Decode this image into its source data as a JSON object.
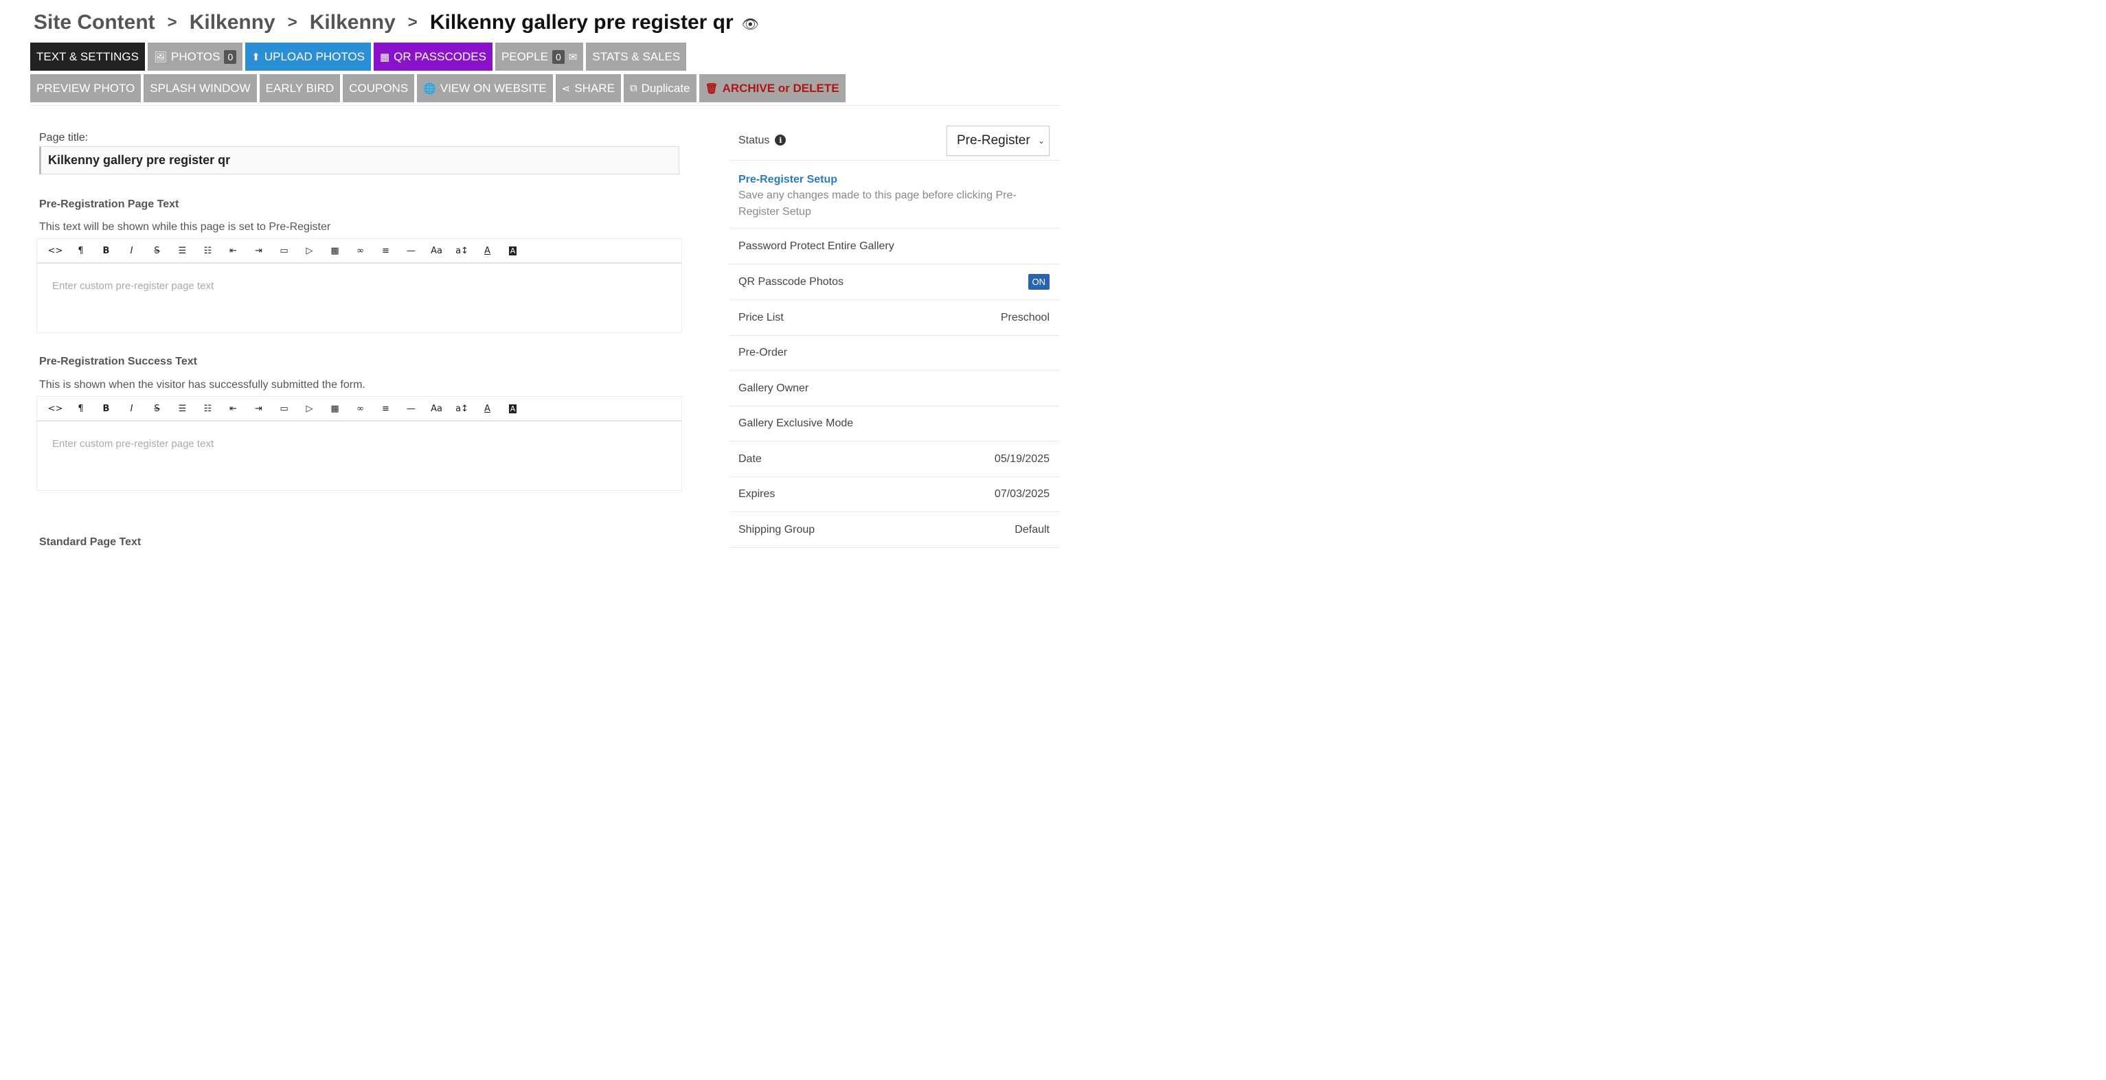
{
  "breadcrumb": {
    "items": [
      "Site Content",
      "Kilkenny",
      "Kilkenny"
    ],
    "current": "Kilkenny gallery pre register qr"
  },
  "tabs_row1": [
    {
      "name": "text-settings",
      "label": "TEXT & SETTINGS"
    },
    {
      "name": "photos",
      "label": "PHOTOS",
      "badge": "0"
    },
    {
      "name": "upload-photos",
      "label": "UPLOAD PHOTOS"
    },
    {
      "name": "qr-passcodes",
      "label": "QR PASSCODES"
    },
    {
      "name": "people",
      "label": "PEOPLE",
      "badge": "0"
    },
    {
      "name": "stats-sales",
      "label": "STATS & SALES"
    }
  ],
  "tabs_row2": [
    {
      "name": "preview-photo",
      "label": "PREVIEW PHOTO"
    },
    {
      "name": "splash-window",
      "label": "SPLASH WINDOW"
    },
    {
      "name": "early-bird",
      "label": "EARLY BIRD"
    },
    {
      "name": "coupons",
      "label": "COUPONS"
    },
    {
      "name": "view-on-website",
      "label": "VIEW ON WEBSITE"
    },
    {
      "name": "share",
      "label": "SHARE"
    },
    {
      "name": "duplicate",
      "label": "Duplicate"
    },
    {
      "name": "archive-delete",
      "label": "ARCHIVE or DELETE"
    }
  ],
  "form": {
    "page_title_label": "Page title:",
    "page_title_value": "Kilkenny gallery pre register qr",
    "prereg": {
      "title": "Pre-Registration Page Text",
      "desc": "This text will be shown while this page is set to Pre-Register",
      "placeholder": "Enter custom pre-register page text"
    },
    "success": {
      "title": "Pre-Registration Success Text",
      "desc": "This is shown when the visitor has successfully submitted the form.",
      "placeholder": "Enter custom pre-register page text"
    },
    "standard_title": "Standard Page Text"
  },
  "toolbar_glyphs": [
    "<>",
    "¶",
    "B",
    "I",
    "S",
    "≔",
    "⒈",
    "⇤",
    "⇥",
    "▣",
    "▶",
    "▦",
    "⊂⊃",
    "≡",
    "—",
    "Aa",
    "a↕",
    "A",
    "▣"
  ],
  "sidebar": {
    "status_label": "Status",
    "status_value": "Pre-Register",
    "setup_link": "Pre-Register Setup",
    "setup_note": "Save any changes made to this page before clicking Pre-Register Setup",
    "password_protect": "Password Protect Entire Gallery",
    "qr_passcode_label": "QR Passcode Photos",
    "qr_passcode_value": "ON",
    "price_list_label": "Price List",
    "price_list_value": "Preschool",
    "pre_order": "Pre-Order",
    "gallery_owner": "Gallery Owner",
    "exclusive_mode": "Gallery Exclusive Mode",
    "date_label": "Date",
    "date_value": "05/19/2025",
    "expires_label": "Expires",
    "expires_value": "07/03/2025",
    "shipping_label": "Shipping Group",
    "shipping_value": "Default"
  }
}
